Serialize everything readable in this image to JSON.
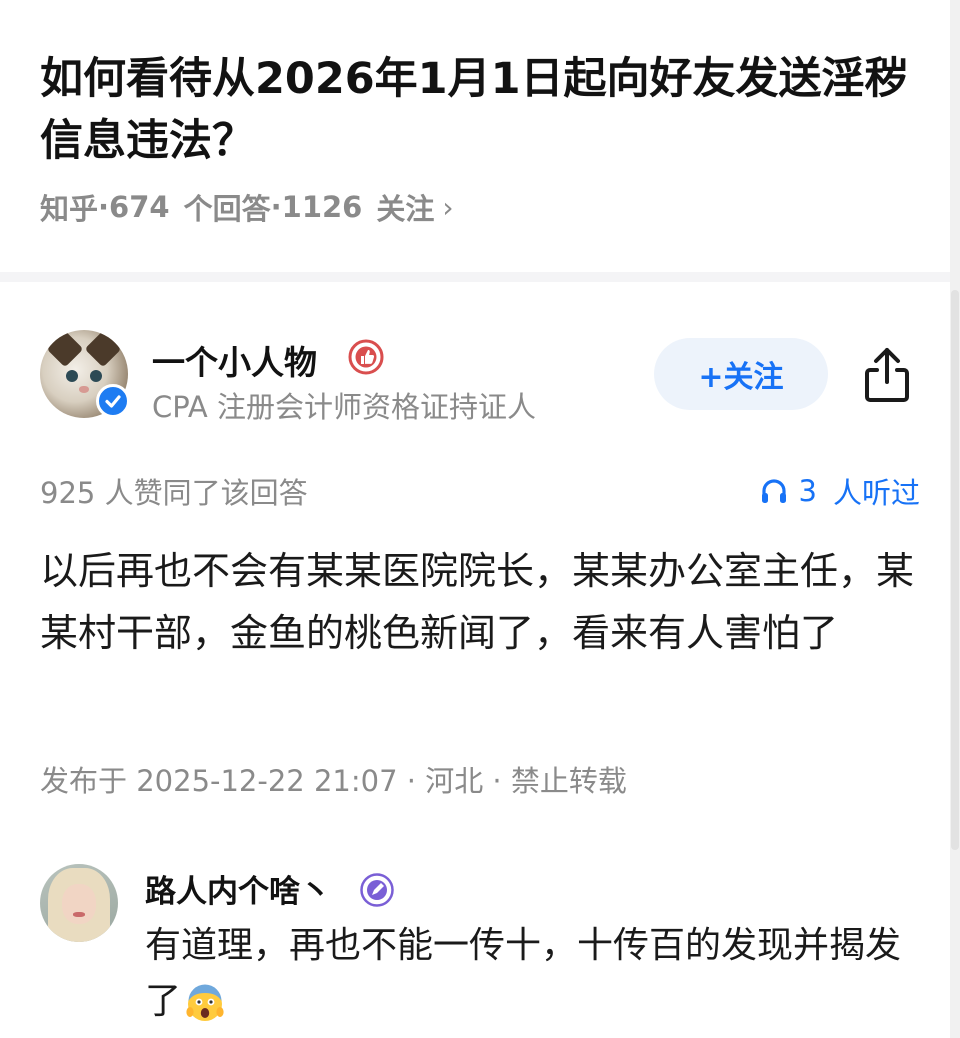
{
  "question": {
    "title": "如何看待从2026年1月1日起向好友发送淫秽信息违法？",
    "source": "知乎",
    "answers_count": "674",
    "answers_label": "个回答",
    "followers_count": "1126",
    "followers_label": "关注",
    "separator": " · ",
    "chevron": "›"
  },
  "answer": {
    "author": {
      "name": "一个小人物",
      "description": "CPA  注册会计师资格证持证人",
      "avatar_icon": "cat-avatar",
      "verified_icon": "verified-check-icon",
      "badge_icon": "thumbs-up-badge-icon"
    },
    "follow_button_label": "+关注",
    "share_icon": "share-icon",
    "approve_text": "925  人赞同了该回答",
    "listen": {
      "icon": "headphones-icon",
      "count": "3",
      "label": "人听过"
    },
    "content": "以后再也不会有某某医院院长，某某办公室主任，某某村干部，金鱼的桃色新闻了，看来有人害怕了",
    "publish_info": "发布于  2025-12-22  21:07 · 河北 · 禁止转载"
  },
  "comment": {
    "author_name": "路人内个啥丶",
    "badge_icon": "pen-badge-icon",
    "text": "有道理，再也不能一传十，十传百的发现并揭发了",
    "emoji": "screaming-face-emoji"
  },
  "colors": {
    "accent": "#1772f6",
    "follow_bg": "#edf3fb",
    "meta_gray": "#8a8a8a",
    "badge_red": "#d94e4e",
    "badge_purple": "#7a5fd6"
  }
}
